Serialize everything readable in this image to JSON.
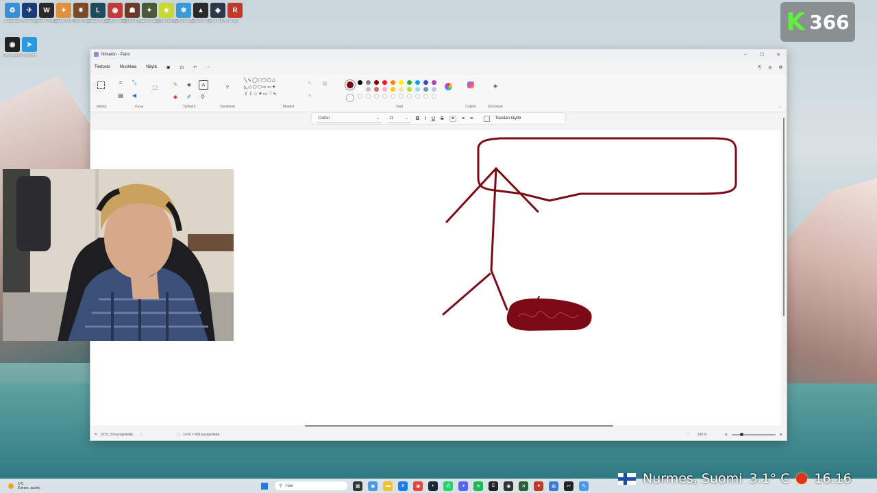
{
  "desktop": {
    "icons_row1": [
      {
        "label": "Roskakori",
        "color": "#3b8fd6",
        "glyph": "♻"
      },
      {
        "label": "Alien Wake",
        "color": "#1a3a7a",
        "glyph": "✈"
      },
      {
        "label": "World of Warcraft",
        "color": "#2a2a2a",
        "glyph": "W"
      },
      {
        "label": "Counter-Stri... 2",
        "color": "#e0903a",
        "glyph": "✦"
      },
      {
        "label": "Path of Exile",
        "color": "#7a4a2a",
        "glyph": "✷"
      },
      {
        "label": "League of Legends",
        "color": "#1f4a5a",
        "glyph": "L"
      },
      {
        "label": "Google Chrome...",
        "color": "#c33a3a",
        "glyph": "◉"
      },
      {
        "label": "Kingdom Co... 2 Deliverance",
        "color": "#6a3a2a",
        "glyph": "☗"
      },
      {
        "label": "Counter-Strike Global...",
        "color": "#4a5a3a",
        "glyph": "✦"
      },
      {
        "label": "MySummerCar",
        "color": "#c8d83a",
        "glyph": "★"
      },
      {
        "label": "My Winter Car",
        "color": "#3a9ad8",
        "glyph": "❄"
      },
      {
        "label": "Battlefield™ 6",
        "color": "#2a2a2a",
        "glyph": "▲"
      },
      {
        "label": "Call of Duty® Black Ops",
        "color": "#2a3a4a",
        "glyph": "◆"
      },
      {
        "label": "Rust",
        "color": "#c23a2a",
        "glyph": "R"
      }
    ],
    "icons_row2": [
      {
        "label": "OBS Studio",
        "color": "#222222",
        "glyph": "◉"
      },
      {
        "label": "Telegram",
        "color": "#2a9ae0",
        "glyph": "➤"
      }
    ]
  },
  "overlay": {
    "k_letter": "K",
    "k_number": "366",
    "k_color": "#5ef03c"
  },
  "paint": {
    "title": "Nimetön - Paint",
    "menu": [
      "Tiedosto",
      "Muokkaa",
      "Näytä"
    ],
    "groups": [
      "Valinta",
      "Kuva",
      "Työkalut",
      "Siveltimet",
      "Muodot",
      "Värit",
      "Copilot",
      "Kerrokset"
    ],
    "active_color": "#7c0a16",
    "palette_row1": [
      "#000000",
      "#7f7f7f",
      "#880015",
      "#ed1c24",
      "#ff7f27",
      "#fff200",
      "#22b14c",
      "#00a2e8",
      "#3f48cc",
      "#a349a4"
    ],
    "palette_row2": [
      "#ffffff",
      "#c3c3c3",
      "#b97a57",
      "#ffaec9",
      "#ffc90e",
      "#efe4b0",
      "#b5e61d",
      "#99d9ea",
      "#7092be",
      "#c8bfe7"
    ],
    "font_name": "Calibri",
    "font_size": "11",
    "fill_label": "Taustan täyttö",
    "status_cursor": "1073, 20 kuvapistettä",
    "status_size": "1476 × 683 kuvapistettä",
    "zoom": "190 %",
    "drawing_color": "#7c0a16"
  },
  "taskbar": {
    "weather_temp": "6°C",
    "weather_desc": "Enimm. aurink.",
    "search": "Hae",
    "location": "Nurmes, Suomi",
    "temperature": "3.1° C",
    "time": "16.16"
  }
}
